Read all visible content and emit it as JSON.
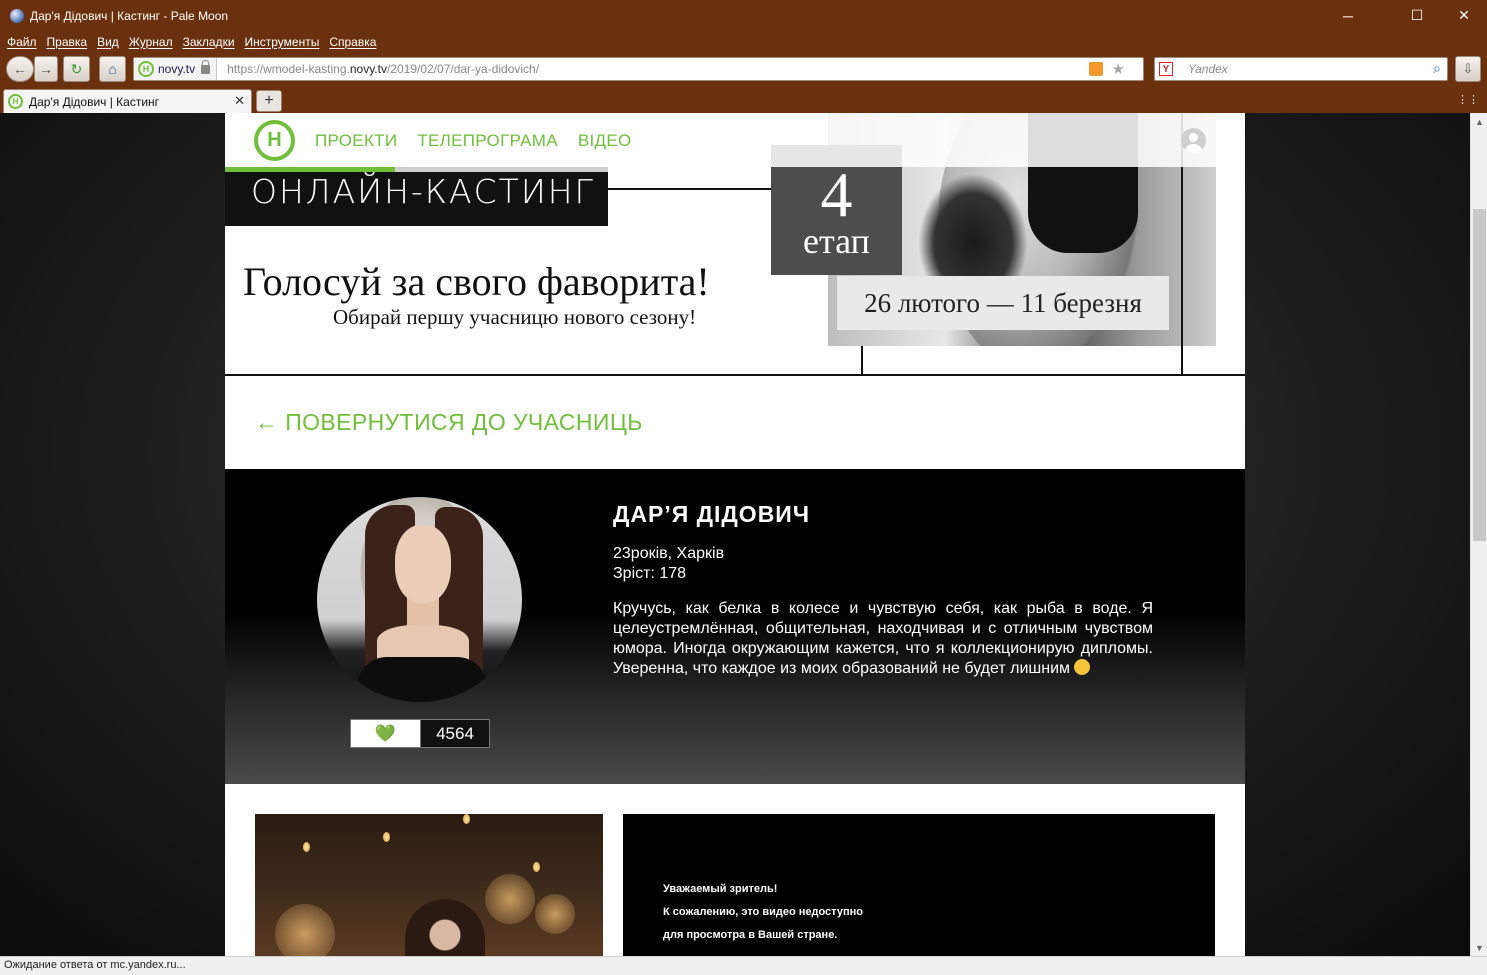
{
  "window": {
    "title": "Дар'я Дідович | Кастинг - Pale Moon",
    "minimize": "─",
    "maximize": "☐",
    "close": "✕"
  },
  "menu": {
    "items": [
      "Файл",
      "Правка",
      "Вид",
      "Журнал",
      "Закладки",
      "Инструменты",
      "Справка"
    ]
  },
  "navigation": {
    "back_icon": "←",
    "forward_icon": "→",
    "reload_icon": "↻",
    "home_icon": "⌂",
    "site_domain": "novy.tv",
    "url_prefix": "https://wmodel-kasting.",
    "url_domain": "novy.tv",
    "url_path": "/2019/02/07/dar-ya-didovich/",
    "bookmark_star": "★",
    "search_engine": "Yandex",
    "search_icon": "⌕",
    "download_icon": "⇩"
  },
  "tabs": [
    {
      "label": "Дар'я Дідович | Кастинг",
      "close": "✕"
    }
  ],
  "new_tab_label": "+",
  "all_tabs_icon": "⋮⋮",
  "site": {
    "logo_letter": "Н",
    "nav": [
      "ПРОЕКТИ",
      "ТЕЛЕПРОГРАМА",
      "ВІДЕО"
    ]
  },
  "banner": {
    "casting_label": "ОНЛАЙН-КАСТИНГ",
    "stage_number": "4",
    "stage_label": "етап",
    "dates": "26 лютого — 11 березня",
    "title": "Голосуй за свого фаворита!",
    "subtitle": "Обирай першу учасницю нового сезону!"
  },
  "back_link": "← ПОВЕРНУТИСЯ ДО УЧАСНИЦЬ",
  "profile": {
    "name": "ДАР’Я ДІДОВИЧ",
    "age_city": "23років, Харків",
    "height": "Зріст: 178",
    "bio": "Кручусь, как белка в колесе и чувствую себя, как рыба в воде. Я целеустремлённая, общительная, находчивая и с отличным чувством юмора. Иногда окружающим кажется, что я коллекционирую дипломы. Уверенна, что каждое из моих образований не будет лишним",
    "likes": "4564",
    "heart": "💚"
  },
  "video_notice": {
    "line1": "Уважаемый зритель!",
    "line2": "К сожалению, это видео недоступно",
    "line3": "для просмотра в Вашей стране."
  },
  "status": {
    "text": "Ожидание ответа от mc.yandex.ru..."
  },
  "colors": {
    "chrome": "#6b300d",
    "brand_green": "#6fbf3a",
    "heart_green": "#5fc22e"
  }
}
